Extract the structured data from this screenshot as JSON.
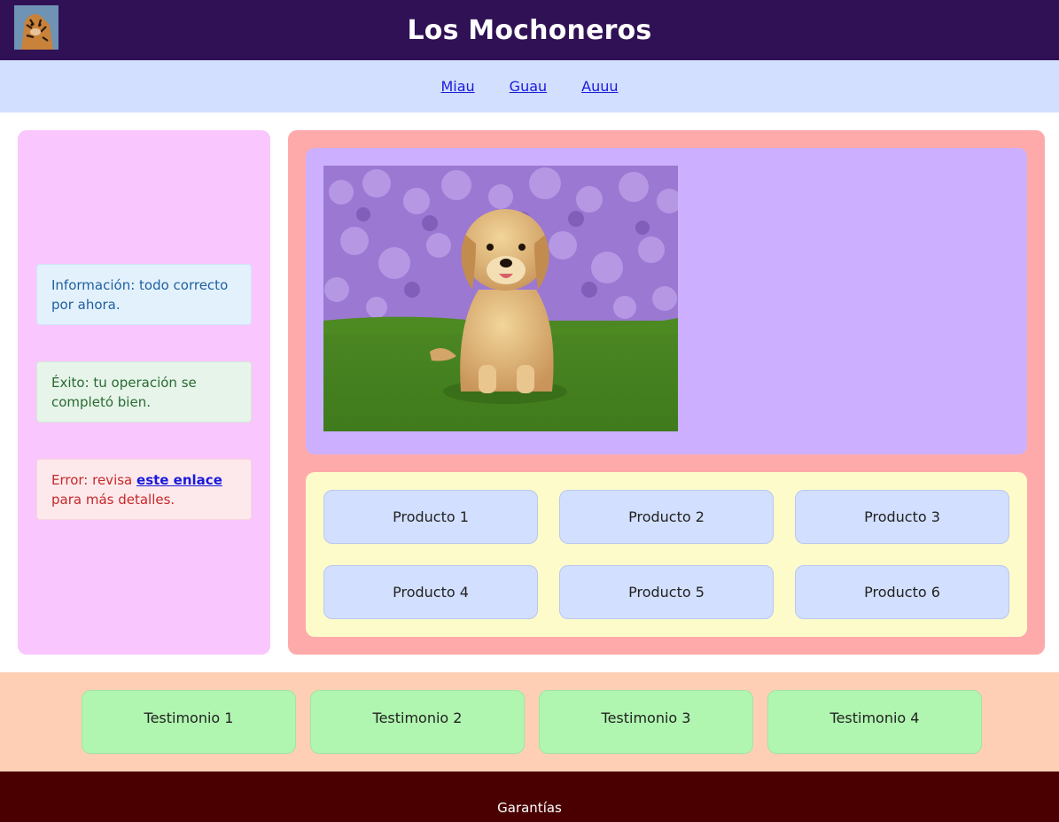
{
  "header": {
    "title": "Los Mochoneros",
    "logo_icon": "tiger-photo-icon"
  },
  "nav": {
    "items": [
      {
        "label": "Miau"
      },
      {
        "label": "Guau"
      },
      {
        "label": "Auuu"
      }
    ]
  },
  "sidebar": {
    "info": "Información: todo correcto por ahora.",
    "success": "Éxito: tu operación se completó bien.",
    "error": {
      "prefix": "Error: revisa ",
      "link": "este enlace",
      "suffix": " para más detalles."
    }
  },
  "hero": {
    "image_icon": "puppy-photo-icon"
  },
  "products": [
    {
      "label": "Producto 1"
    },
    {
      "label": "Producto 2"
    },
    {
      "label": "Producto 3"
    },
    {
      "label": "Producto 4"
    },
    {
      "label": "Producto 5"
    },
    {
      "label": "Producto 6"
    }
  ],
  "testimonials": [
    {
      "label": "Testimonio 1"
    },
    {
      "label": "Testimonio 2"
    },
    {
      "label": "Testimonio 3"
    },
    {
      "label": "Testimonio 4"
    }
  ],
  "footer": {
    "text": "Garantías"
  },
  "colors": {
    "header_bg": "#311155",
    "nav_bg": "#d2dffe",
    "sidebar_bg": "#fac6fe",
    "content_bg": "#ffaaaa",
    "hero_bg": "#ccb0ff",
    "products_bg": "#fefbcb",
    "testimonials_bg": "#ffcfb5",
    "testimonial_card": "#b0f6b0",
    "footer_bg": "#4a0000"
  }
}
